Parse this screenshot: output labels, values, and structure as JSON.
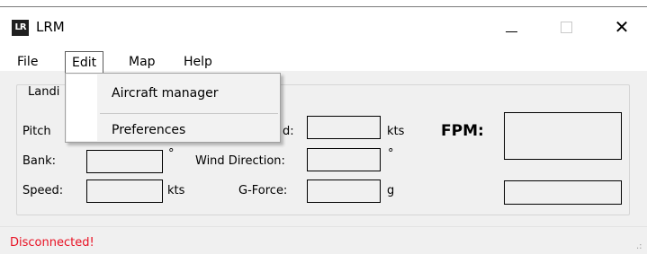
{
  "window": {
    "title": "LRM",
    "icon": "lrm-app-icon",
    "close_glyph": "✕"
  },
  "menu": {
    "file": "File",
    "edit": "Edit",
    "map": "Map",
    "help": "Help"
  },
  "edit_menu": {
    "items": [
      "Aircraft manager",
      "Preferences"
    ]
  },
  "landing_group": {
    "label": "Landi"
  },
  "fields": {
    "pitch_label": "Pitch",
    "bank_label": "Bank:",
    "speed_label": "Speed:",
    "wind_speed_label": "d:",
    "wind_direction_label": "Wind Direction:",
    "gforce_label": "G-Force:",
    "fpm_label": "FPM:",
    "pitch_value": "",
    "bank_value": "",
    "speed_value": "",
    "wind_speed_value": "",
    "wind_direction_value": "",
    "gforce_value": "",
    "fpm_value": "",
    "extra_value": ""
  },
  "units": {
    "bank_unit": "°",
    "speed_unit": "kts",
    "wind_speed_unit": "kts",
    "wind_direction_unit": "°",
    "gforce_unit": "g"
  },
  "status": {
    "text": "Disconnected!",
    "color": "#e81123"
  },
  "grip": ".:"
}
